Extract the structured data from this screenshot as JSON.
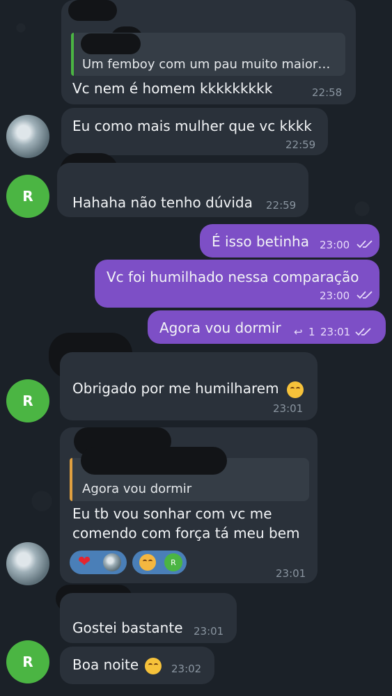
{
  "messages": [
    {
      "quote": "Um femboy com um pau muito maior…",
      "text": "Vc nem é homem kkkkkkkkk",
      "time": "22:58"
    },
    {
      "text": "Eu como mais mulher que vc kkkk",
      "time": "22:59"
    },
    {
      "text": "Hahaha não tenho dúvida",
      "time": "22:59",
      "avatar": "R"
    },
    {
      "text": "É isso betinha",
      "time": "23:00"
    },
    {
      "text": "Vc foi humilhado nessa comparação",
      "time": "23:00"
    },
    {
      "text": "Agora vou dormir",
      "time": "23:01",
      "reply_count": "1"
    },
    {
      "text": "Obrigado por me humilharem",
      "time": "23:01",
      "avatar": "R"
    },
    {
      "quote": "Agora vou dormir",
      "line1": "Eu tb vou sonhar com vc me",
      "line2": "comendo com força tá meu bem",
      "time": "23:01",
      "reaction_avatar": "R"
    },
    {
      "text": "Gostei bastante",
      "time": "23:01"
    },
    {
      "text": "Boa noite",
      "time": "23:02",
      "avatar": "R"
    }
  ],
  "colors": {
    "incoming": "#2a313a",
    "outgoing": "#7d4fc6",
    "quote_bar_1": "#4bb543",
    "quote_bar_2": "#e0a040"
  },
  "icons": [
    "smile-emoji",
    "heart-reaction",
    "smiling-hearts-emoji",
    "double-check-icon",
    "reply-arrow-icon"
  ]
}
